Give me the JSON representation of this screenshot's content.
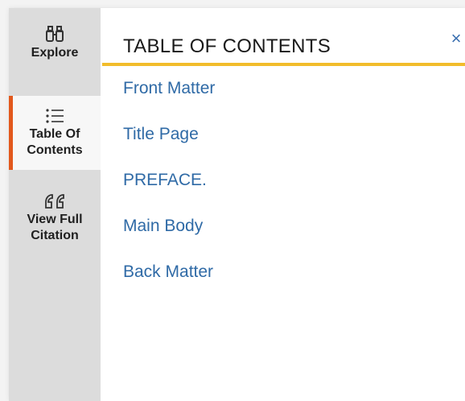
{
  "sidebar": {
    "items": [
      {
        "label": "Explore",
        "icon": "binoculars-icon",
        "active": false
      },
      {
        "label": "Table Of Contents",
        "icon": "list-icon",
        "active": true
      },
      {
        "label": "View Full Citation",
        "icon": "quote-icon",
        "active": false
      }
    ]
  },
  "toc": {
    "title": "TABLE OF CONTENTS",
    "close_label": "×",
    "entries": [
      "Front Matter",
      "Title Page",
      "PREFACE.",
      "Main Body",
      "Back Matter"
    ]
  },
  "colors": {
    "accent": "#e2581c",
    "underline": "#f2bc2b",
    "link": "#2f6aa6"
  }
}
